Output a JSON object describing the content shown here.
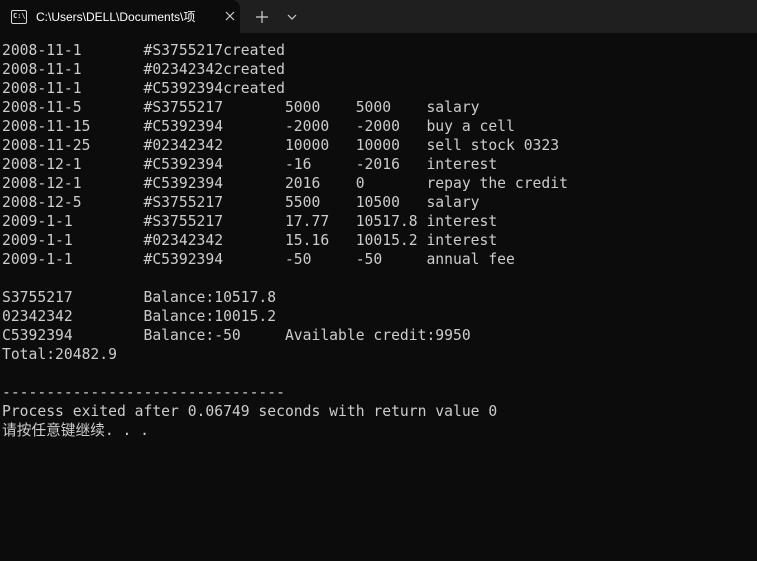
{
  "window": {
    "tab_title": "C:\\Users\\DELL\\Documents\\项",
    "icon_glyph": "C:\\",
    "icons": {
      "terminal": "terminal-icon",
      "close": "close-icon",
      "new_tab": "plus-icon",
      "dropdown": "chevron-down-icon"
    }
  },
  "terminal": {
    "lines": [
      "2008-11-1       #S3755217created",
      "2008-11-1       #02342342created",
      "2008-11-1       #C5392394created",
      "2008-11-5       #S3755217       5000    5000    salary",
      "2008-11-15      #C5392394       -2000   -2000   buy a cell",
      "2008-11-25      #02342342       10000   10000   sell stock 0323",
      "2008-12-1       #C5392394       -16     -2016   interest",
      "2008-12-1       #C5392394       2016    0       repay the credit",
      "2008-12-5       #S3755217       5500    10500   salary",
      "2009-1-1        #S3755217       17.77   10517.8 interest",
      "2009-1-1        #02342342       15.16   10015.2 interest",
      "2009-1-1        #C5392394       -50     -50     annual fee",
      "",
      "S3755217        Balance:10517.8",
      "02342342        Balance:10015.2",
      "C5392394        Balance:-50     Available credit:9950",
      "Total:20482.9",
      "",
      "--------------------------------",
      "Process exited after 0.06749 seconds with return value 0",
      "请按任意键继续. . ."
    ]
  }
}
